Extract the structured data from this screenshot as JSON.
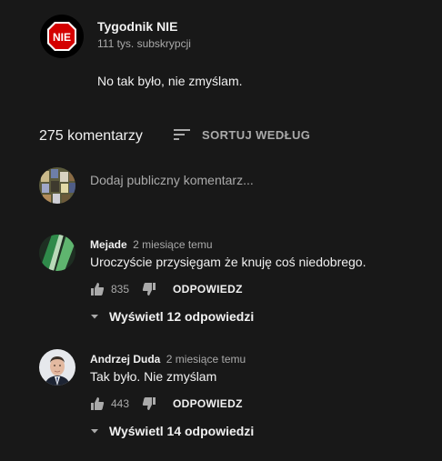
{
  "channel": {
    "name": "Tygodnik NIE",
    "subscribers": "111 tys. subskrypcji",
    "logo_text": "NIE",
    "logo_color": "#d40000"
  },
  "video": {
    "description": "No tak było, nie zmyślam."
  },
  "comments_section": {
    "count_label": "275 komentarzy",
    "sort_label": "SORTUJ WEDŁUG",
    "sort_icon": "sort-icon",
    "input_placeholder": "Dodaj publiczny komentarz..."
  },
  "comments": [
    {
      "author": "Mejade",
      "time": "2 miesiące temu",
      "text": "Uroczyście przysięgam że knuję coś niedobrego.",
      "likes": "835",
      "reply_label": "ODPOWIEDZ",
      "view_replies": "Wyświetl 12 odpowiedzi"
    },
    {
      "author": "Andrzej Duda",
      "time": "2 miesiące temu",
      "text": "Tak było. Nie zmyślam",
      "likes": "443",
      "reply_label": "ODPOWIEDZ",
      "view_replies": "Wyświetl 14 odpowiedzi"
    }
  ],
  "colors": {
    "background": "#181818",
    "text_primary": "#f1f1f1",
    "text_secondary": "#aaaaaa"
  }
}
